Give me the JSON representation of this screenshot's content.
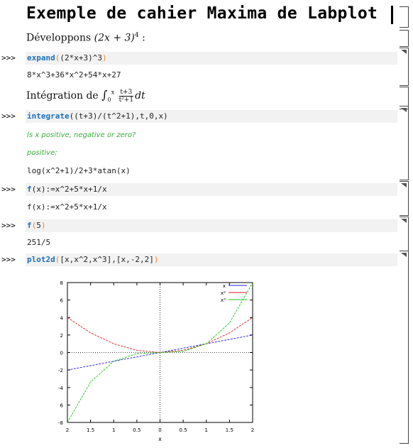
{
  "title": "Exemple de cahier Maxima de Labplot",
  "prompt": ">>>",
  "text1": {
    "prefix": "Développons ",
    "math": "(2x + 3)",
    "sup": "4",
    "suffix": " :"
  },
  "cmd1": {
    "fn": "expand",
    "open": "(",
    "arg": "(2*x+3)^3",
    "close": ")"
  },
  "out1": "8*x^3+36*x^2+54*x+27",
  "text2": {
    "prefix": "Intégration de ",
    "int_sign": "∫",
    "int_upper": "x",
    "int_lower": "0",
    "num": "t+3",
    "den": "t²+1",
    "dt": "dt"
  },
  "cmd2": {
    "fn": "integrate",
    "args": "((t+3)/(t^2+1),t,0,x)"
  },
  "question": "Is x positive, negative or zero?",
  "answer": "positive;",
  "out2": "log(x^2+1)/2+3*atan(x)",
  "cmd3": {
    "fn": "f",
    "args": "(x):=x^2+5*x+1/x"
  },
  "out3": "f(x):=x^2+5*x+1/x",
  "cmd4": {
    "fn": "f",
    "open": "(",
    "arg": "5",
    "close": ")"
  },
  "out4": "251/5",
  "cmd5": {
    "fn": "plot2d",
    "open": "(",
    "arg": "[x,x^2,x^3],[x,-2,2]",
    "close": ")"
  },
  "colors": {
    "keyword": "#1e6fbb",
    "paren": "#e8862a",
    "italic_q": "#3cab3c",
    "series_x": "#1f1fdc",
    "series_x2": "#d21f1f",
    "series_x3": "#19c419"
  },
  "chart_data": {
    "type": "line",
    "xlabel": "x",
    "xlim": [
      -2,
      2
    ],
    "ylim": [
      -8,
      8
    ],
    "x_ticks": [
      "2",
      "1.5",
      "1",
      "0.5",
      "0",
      "0.5",
      "1",
      "1.5",
      "2"
    ],
    "y_ticks": [
      "8",
      "6",
      "4",
      "2",
      "0",
      "-2",
      "-4",
      "6",
      "-8"
    ],
    "series": [
      {
        "name": "x",
        "color": "#1f1fdc",
        "x": [
          -2,
          -1,
          0,
          1,
          2
        ],
        "y": [
          -2,
          -1,
          0,
          1,
          2
        ]
      },
      {
        "name": "x^2",
        "color": "#d21f1f",
        "x": [
          -2,
          -1.5,
          -1,
          -0.5,
          0,
          0.5,
          1,
          1.5,
          2
        ],
        "y": [
          4,
          2.25,
          1,
          0.25,
          0,
          0.25,
          1,
          2.25,
          4
        ]
      },
      {
        "name": "x^3",
        "color": "#19c419",
        "x": [
          -2,
          -1.5,
          -1,
          -0.5,
          0,
          0.5,
          1,
          1.5,
          2
        ],
        "y": [
          -8,
          -3.375,
          -1,
          -0.125,
          0,
          0.125,
          1,
          3.375,
          8
        ]
      }
    ],
    "legend": [
      "x",
      "x²",
      "x³"
    ],
    "legend_position": "top-right",
    "grid": false
  }
}
